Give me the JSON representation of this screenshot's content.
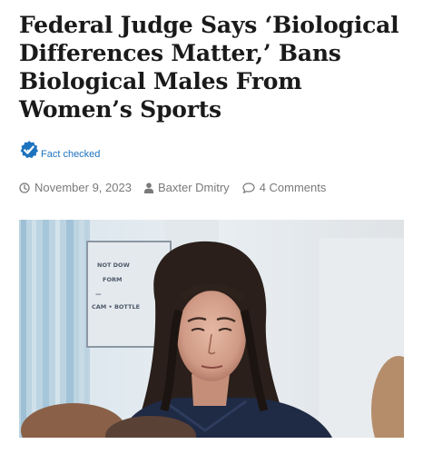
{
  "article": {
    "title": "Federal Judge Says ‘Biological Differences Matter,’ Bans Biological Males From Women’s Sports",
    "fact_check_label": "Fact checked",
    "date": "November 9, 2023",
    "author": "Baxter Dmitry",
    "comments": "4 Comments",
    "image": {
      "sign_lines": [
        "NOT DOW",
        "FORM",
        "—",
        "CAM • BOTTLE"
      ]
    }
  },
  "icons": {
    "fact_check": "checkmark-badge-icon",
    "date": "clock-icon",
    "author": "user-icon",
    "comments": "speech-bubble-icon"
  },
  "colors": {
    "link": "#1e73be",
    "meta": "#7a7a7a",
    "title": "#1a1a1a"
  }
}
